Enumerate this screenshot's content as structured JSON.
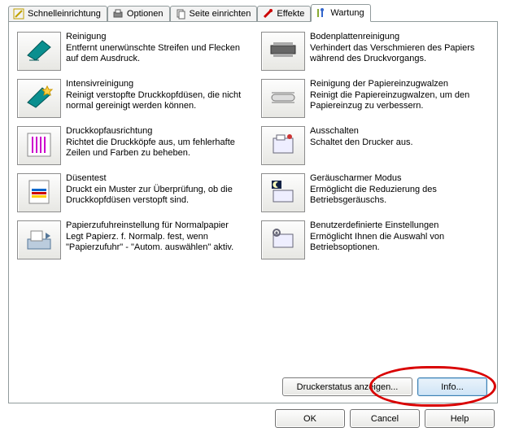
{
  "tabs": {
    "quick": "Schnelleinrichtung",
    "options": "Optionen",
    "pagesetup": "Seite einrichten",
    "effects": "Effekte",
    "maintenance": "Wartung"
  },
  "left": {
    "cleaning": {
      "title": "Reinigung",
      "desc": "Entfernt unerwünschte Streifen und Flecken auf dem Ausdruck."
    },
    "deep": {
      "title": "Intensivreinigung",
      "desc": "Reinigt verstopfte Druckkopfdüsen, die nicht normal gereinigt werden können."
    },
    "align": {
      "title": "Druckkopfausrichtung",
      "desc": "Richtet die Druckköpfe aus, um fehlerhafte Zeilen und Farben zu beheben."
    },
    "nozzle": {
      "title": "Düsentest",
      "desc": "Druckt ein Muster zur Überprüfung, ob die Druckkopfdüsen verstopft sind."
    },
    "paper": {
      "title": "Papierzufuhreinstellung für Normalpapier",
      "desc": "Legt Papierz. f. Normalp. fest, wenn \"Papierzufuhr\" - \"Autom. auswählen\" aktiv."
    }
  },
  "right": {
    "bottom": {
      "title": "Bodenplattenreinigung",
      "desc": "Verhindert das Verschmieren des Papiers während des Druckvorgangs."
    },
    "roller": {
      "title": "Reinigung der Papiereinzugwalzen",
      "desc": "Reinigt die Papiereinzugwalzen, um den Papiereinzug zu verbessern."
    },
    "poweroff": {
      "title": "Ausschalten",
      "desc": "Schaltet den Drucker aus."
    },
    "quiet": {
      "title": "Geräuscharmer Modus",
      "desc": "Ermöglicht die Reduzierung des Betriebsgeräuschs."
    },
    "custom": {
      "title": "Benutzerdefinierte Einstellungen",
      "desc": "Ermöglicht Ihnen die Auswahl von Betriebsoptionen."
    }
  },
  "panelButtons": {
    "status": "Druckerstatus anzeigen...",
    "info": "Info..."
  },
  "footer": {
    "ok": "OK",
    "cancel": "Cancel",
    "help": "Help"
  }
}
